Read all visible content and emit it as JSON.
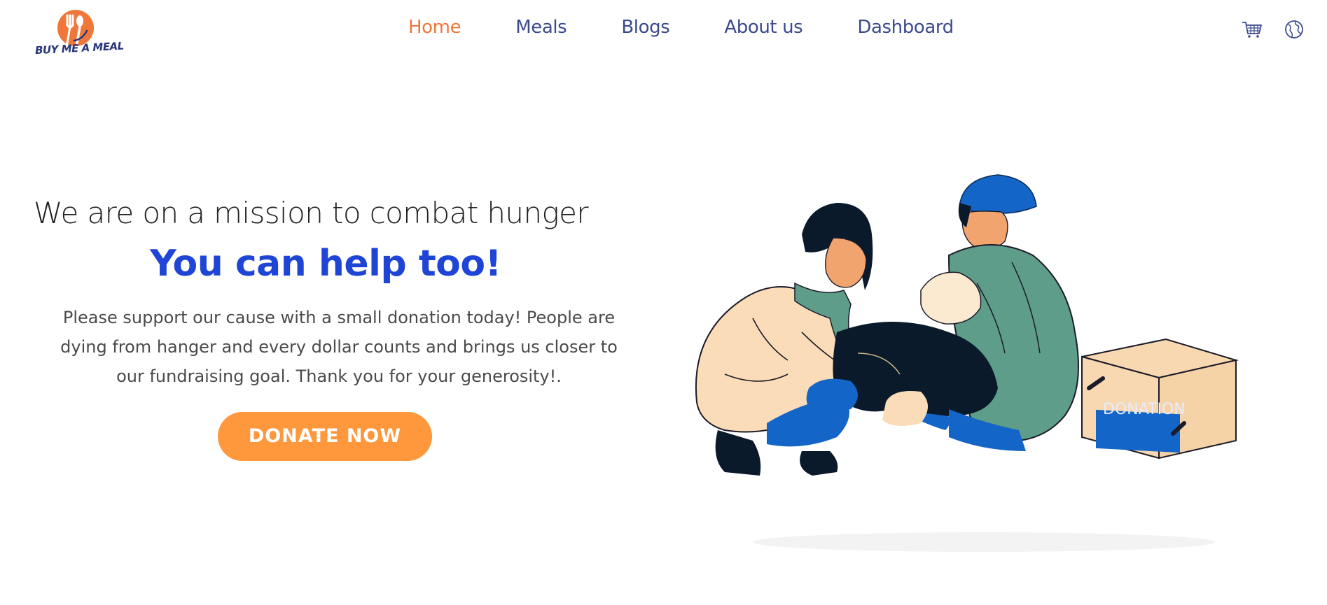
{
  "brand": {
    "name": "BUY ME A MEAL",
    "color_primary": "#f0773a",
    "color_text": "#27357a"
  },
  "nav": {
    "items": [
      {
        "label": "Home",
        "active": true
      },
      {
        "label": "Meals",
        "active": false
      },
      {
        "label": "Blogs",
        "active": false
      },
      {
        "label": "About us",
        "active": false
      },
      {
        "label": "Dashboard",
        "active": false
      }
    ]
  },
  "header_icons": {
    "cart": "cart-icon",
    "language": "globe-icon"
  },
  "hero": {
    "tagline": "We are on a mission to combat hunger",
    "headline": "You can help too!",
    "description": "Please support our cause with a small donation today! People are dying from hanger and every dollar counts and brings us closer to our fundraising goal. Thank you for your generosity!.",
    "cta_label": "DONATE NOW",
    "cta_color": "#ff973d",
    "headline_color": "#1f45d6"
  },
  "illustration": {
    "box_label": "DONATION"
  }
}
